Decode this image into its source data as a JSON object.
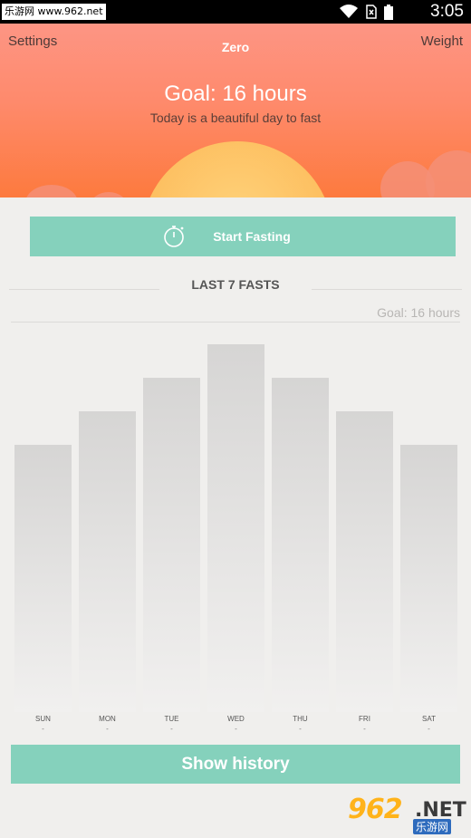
{
  "status_bar": {
    "watermark": "乐游网 www.962.net",
    "time": "3:05",
    "icons": [
      "wifi-icon",
      "no-sim-icon",
      "battery-icon"
    ]
  },
  "header": {
    "settings_label": "Settings",
    "app_title": "Zero",
    "weight_label": "Weight",
    "goal_title": "Goal: 16 hours",
    "subtitle": "Today is a beautiful day to fast"
  },
  "start_button": {
    "label": "Start Fasting",
    "icon": "stopwatch-icon"
  },
  "section": {
    "title": "LAST 7 FASTS",
    "goal_label": "Goal: 16 hours"
  },
  "chart_data": {
    "type": "bar",
    "categories": [
      "SUN",
      "MON",
      "TUE",
      "WED",
      "THU",
      "FRI",
      "SAT"
    ],
    "values": [
      16,
      18,
      20,
      22,
      20,
      18,
      16
    ],
    "value_labels": [
      "-",
      "-",
      "-",
      "-",
      "-",
      "-",
      "-"
    ],
    "ylim": [
      0,
      22
    ],
    "title": "",
    "xlabel": "",
    "ylabel": "",
    "grid": false
  },
  "history_button": {
    "label": "Show history"
  },
  "footer_watermark": {
    "logo": "962",
    "suffix": ".NET",
    "sub": "乐游网"
  },
  "colors": {
    "accent": "#85d1bc",
    "header_top": "#fd9584",
    "header_bottom": "#fd7a3e",
    "sun": "#fdbc5c"
  }
}
